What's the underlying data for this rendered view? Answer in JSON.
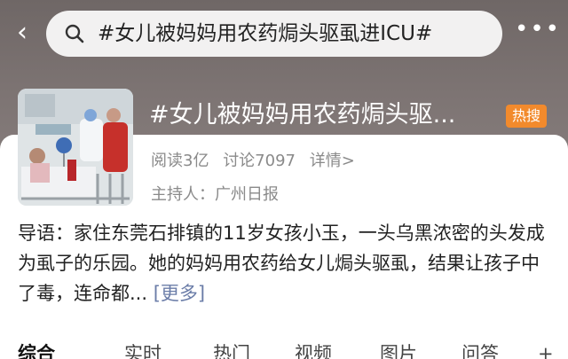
{
  "header": {
    "back_icon": "chevron-left-icon",
    "search_icon": "search-icon",
    "search_query": "#女儿被妈妈用农药焗头驱虱进ICU#",
    "more_icon": "more-dots-icon",
    "more_glyph": "•••"
  },
  "topic": {
    "title": "#女儿被妈妈用农药焗头驱...",
    "badge": "热搜",
    "reads": "阅读3亿",
    "discussions": "讨论7097",
    "details_link": "详情>",
    "host": "主持人：广州日报"
  },
  "intro": {
    "text": "导语：家住东莞石排镇的11岁女孩小玉，一头乌黑浓密的头发成为虱子的乐园。她的妈妈用农药给女儿焗头驱虱，结果让孩子中了毒，连命都...",
    "more_label": "[更多]"
  },
  "tabs": [
    {
      "label": "综合",
      "active": true
    },
    {
      "label": "实时",
      "active": false
    },
    {
      "label": "热门",
      "active": false
    },
    {
      "label": "视频",
      "active": false
    },
    {
      "label": "图片",
      "active": false
    },
    {
      "label": "问答",
      "active": false
    }
  ],
  "tabs_more": "+",
  "colors": {
    "header_bg": "#7a7170",
    "badge_orange": "#f28a2c",
    "link_blue": "#6b7da8"
  }
}
